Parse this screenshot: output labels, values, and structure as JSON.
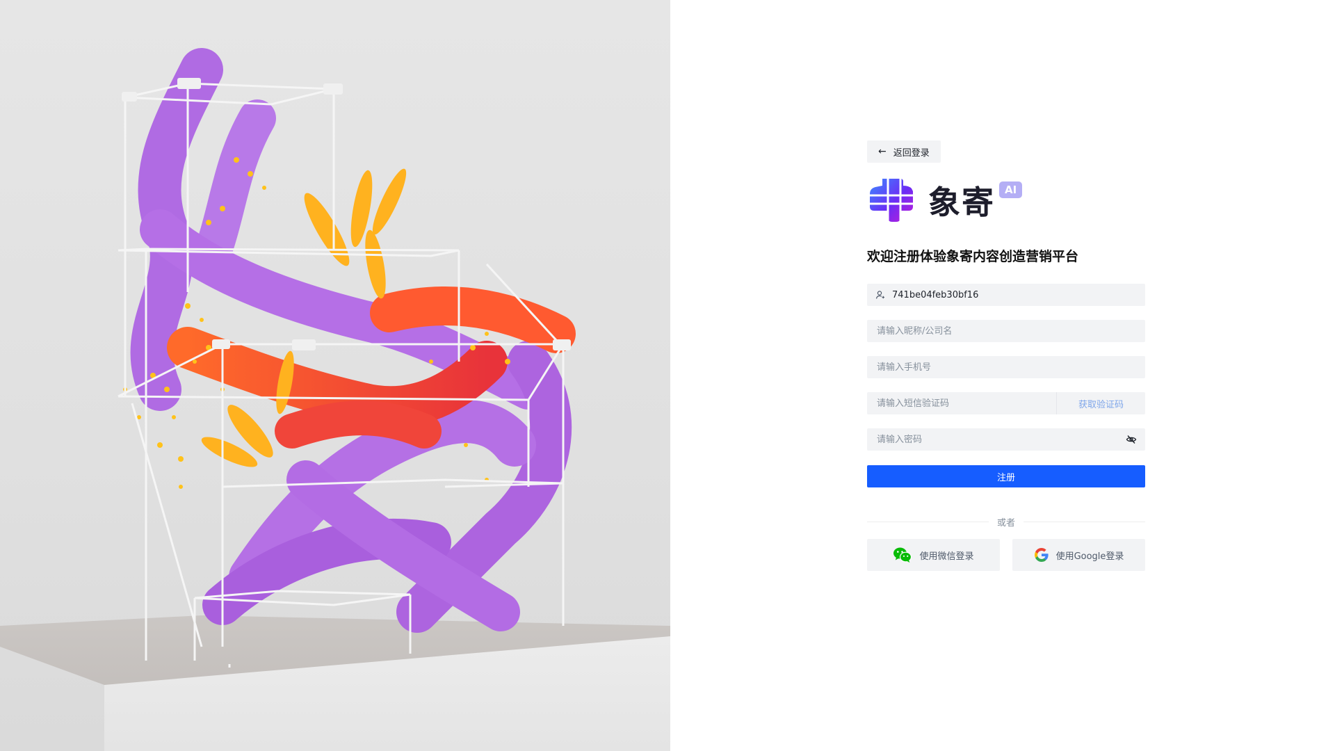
{
  "back": {
    "label": "返回登录",
    "icon": "arrow-left-icon"
  },
  "brand": {
    "name": "象寄",
    "badge": "AI",
    "logo_colors": [
      "#3d8bff",
      "#6b2cf5",
      "#c21dd8"
    ]
  },
  "title": "欢迎注册体验象寄内容创造营销平台",
  "form": {
    "invite_code": {
      "value": "741be04feb30bf16",
      "icon": "user-invite-icon"
    },
    "nickname": {
      "placeholder": "请输入昵称/公司名"
    },
    "phone": {
      "placeholder": "请输入手机号"
    },
    "sms_code": {
      "placeholder": "请输入短信验证码",
      "button": "获取验证码"
    },
    "password": {
      "placeholder": "请输入密码",
      "icon": "eye-hidden-icon"
    },
    "submit": "注册"
  },
  "divider": "或者",
  "social": {
    "wechat": {
      "label": "使用微信登录",
      "icon": "wechat-icon",
      "color": "#09bb07"
    },
    "google": {
      "label": "使用Google登录",
      "icon": "google-icon"
    }
  },
  "colors": {
    "primary": "#165dff",
    "field_bg": "#f2f3f5",
    "link": "#7fa6ea"
  }
}
